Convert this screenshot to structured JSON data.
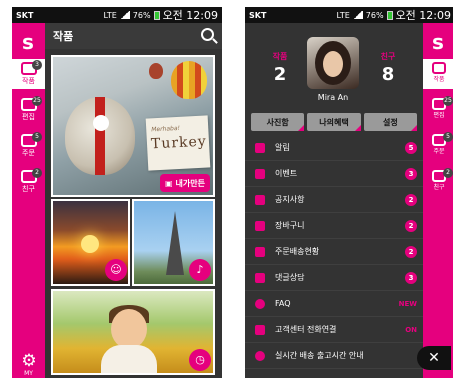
{
  "left": {
    "status": {
      "carrier": "SKT",
      "network": "LTE",
      "battery": "76%",
      "time": "오전 12:09"
    },
    "logo": "s",
    "sidebar": [
      {
        "label": "작품",
        "badge": "3",
        "icon": "camera-icon",
        "active": true
      },
      {
        "label": "편집",
        "badge": "25",
        "icon": "film-icon",
        "active": false
      },
      {
        "label": "주문",
        "badge": "5",
        "icon": "cart-icon",
        "active": false
      },
      {
        "label": "친구",
        "badge": "2",
        "icon": "friends-icon",
        "active": false
      }
    ],
    "settings_label": "MY",
    "title": "작품",
    "photos": {
      "main_card_small": "Merhaba!",
      "main_card_big": "Turkey",
      "mymake_label": "내가만든"
    }
  },
  "right": {
    "status": {
      "carrier": "SKT",
      "network": "LTE",
      "battery": "76%",
      "time": "오전 12:09"
    },
    "stats": {
      "works_label": "작품",
      "works_value": "2",
      "friends_label": "친구",
      "friends_value": "8"
    },
    "username": "Mira An",
    "tabs": [
      "사진함",
      "나의혜택",
      "설정"
    ],
    "menu": [
      {
        "label": "알림",
        "badge": "5",
        "icon": "megaphone-icon"
      },
      {
        "label": "이벤트",
        "badge": "3",
        "icon": "gift-icon"
      },
      {
        "label": "공지사항",
        "badge": "2",
        "icon": "notice-icon"
      },
      {
        "label": "장바구니",
        "badge": "2",
        "icon": "cart-icon"
      },
      {
        "label": "주문배송현황",
        "badge": "2",
        "icon": "truck-icon"
      },
      {
        "label": "댓글상담",
        "badge": "3",
        "icon": "chat-icon"
      },
      {
        "label": "FAQ",
        "tag": "NEW",
        "icon": "question-icon"
      },
      {
        "label": "고객센터 전화연결",
        "tag": "ON",
        "icon": "phone-icon"
      },
      {
        "label": "실시간 배송 출고시간 안내",
        "icon": "clock-icon"
      }
    ],
    "strip": [
      {
        "label": "작품",
        "badge": "",
        "active": true
      },
      {
        "label": "편집",
        "badge": "25",
        "active": false
      },
      {
        "label": "주문",
        "badge": "5",
        "active": false
      },
      {
        "label": "친구",
        "badge": "2",
        "active": false
      }
    ],
    "close_label": "✕"
  }
}
